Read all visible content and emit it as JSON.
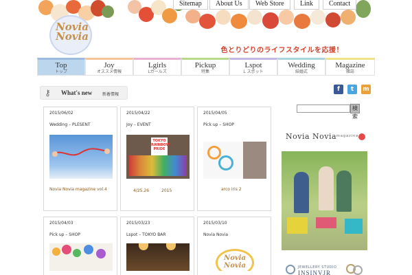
{
  "header": {
    "logo_text": "Novia Novia",
    "tagline": "色とりどりのライフスタイルを応援！",
    "topnav": [
      "Sitemap",
      "About Us",
      "Web Store",
      "Link",
      "Contact"
    ]
  },
  "nav": {
    "items": [
      {
        "en": "Top",
        "jp": "トップ",
        "color": "#9bbbe0"
      },
      {
        "en": "Joy",
        "jp": "オススメ情報",
        "color": "#f5c39a"
      },
      {
        "en": "Lgirls",
        "jp": "Lガールズ",
        "color": "#e9b0cf"
      },
      {
        "en": "Pickup",
        "jp": "特集",
        "color": "#b7d98a"
      },
      {
        "en": "Lspot",
        "jp": "L スポット",
        "color": "#c3b6e6"
      },
      {
        "en": "Wedding",
        "jp": "結婚式",
        "color": "#a9d6df"
      },
      {
        "en": "Magazine",
        "jp": "雑誌",
        "color": "#f1e08a"
      }
    ]
  },
  "whats_new": {
    "label": "What's new",
    "jp": "新着情報"
  },
  "social": [
    {
      "name": "facebook-icon",
      "glyph": "f",
      "color": "#3b5998"
    },
    {
      "name": "twitter-icon",
      "glyph": "t",
      "color": "#4aa6e0"
    },
    {
      "name": "mixi-icon",
      "glyph": "m",
      "color": "#e9a13b"
    }
  ],
  "search": {
    "button": "検索"
  },
  "cards": [
    {
      "date": "2015/06/02",
      "title": "Wedding – PLESENT",
      "caption": "Novia Novia magazine vol.4"
    },
    {
      "date": "2015/04/22",
      "title": "Joy – EVENT",
      "caption": "4/25.26　　　2015"
    },
    {
      "date": "2015/04/05",
      "title": "Pick up – SHOP",
      "caption": "arco iris  2"
    },
    {
      "date": "2015/04/03",
      "title": "Pick up – SHOP",
      "caption": ""
    },
    {
      "date": "2015/03/23",
      "title": "Lspot – TOKYO BAR",
      "caption": ""
    },
    {
      "date": "2015/03/10",
      "title": "Novia Novia",
      "caption": ""
    }
  ],
  "magazine": {
    "title": "Novia Novia",
    "subtitle": "magazine"
  },
  "jewelry": {
    "small": "JEWELLERY STUDIO",
    "big": "INSINVJR"
  },
  "pride_text": "TOKYO RAINBOW PRIDE"
}
